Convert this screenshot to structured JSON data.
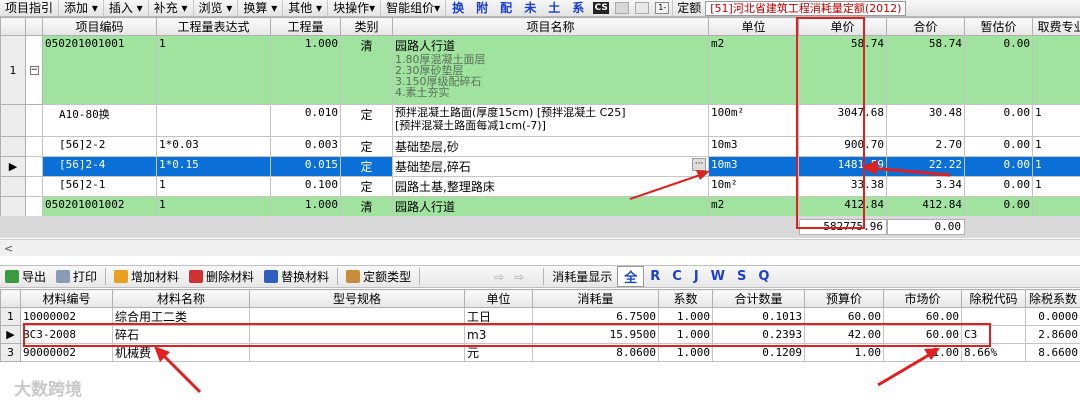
{
  "toolbar": {
    "items": [
      "项目指引",
      "添加 ▾",
      "插入 ▾",
      "补充 ▾",
      "浏览 ▾",
      "换算 ▾",
      "其他 ▾",
      "块操作▾",
      "智能组价▾"
    ],
    "quick": [
      "换",
      "附",
      "配",
      "未",
      "土",
      "系"
    ],
    "quota_label": "定额",
    "quota_value": "[51]河北省建筑工程消耗量定额(2012)"
  },
  "grid": {
    "headers": [
      "项目编码",
      "工程量表达式",
      "工程量",
      "类别",
      "项目名称",
      "单位",
      "单价",
      "合价",
      "暂估价",
      "取费专业"
    ],
    "rows": [
      {
        "idx": "1",
        "code": "050201001001",
        "expr": "1",
        "qty": "1.000",
        "type": "清",
        "name": "园路人行道",
        "desc": [
          "1.80厚混凝土面层",
          "2.30厚砂垫层",
          "3.150厚级配碎石",
          "4.素土夯实"
        ],
        "unit": "m2",
        "price": "58.74",
        "total": "58.74",
        "est": "0.00",
        "fee": ""
      },
      {
        "idx": "",
        "code": "A10-80换",
        "expr": "",
        "qty": "0.010",
        "type": "定",
        "name": "预拌混凝土路面(厚度15cm) [预拌混凝土 C25]",
        "name2": "[预拌混凝土路面每减1cm(-7)]",
        "unit": "100m²",
        "price": "3047.68",
        "total": "30.48",
        "est": "0.00",
        "fee": "1"
      },
      {
        "idx": "",
        "code": "[56]2-2",
        "expr": "1*0.03",
        "qty": "0.003",
        "type": "定",
        "name": "基础垫层,砂",
        "unit": "10m3",
        "price": "900.70",
        "total": "2.70",
        "est": "0.00",
        "fee": "1"
      },
      {
        "idx": "▶",
        "code": "[56]2-4",
        "expr": "1*0.15",
        "qty": "0.015",
        "type": "定",
        "name": "基础垫层,碎石",
        "unit": "10m3",
        "price": "1481.59",
        "total": "22.22",
        "est": "0.00",
        "fee": "1"
      },
      {
        "idx": "",
        "code": "[56]2-1",
        "expr": "1",
        "qty": "0.100",
        "type": "定",
        "name": "园路土基,整理路床",
        "unit": "10m²",
        "price": "33.38",
        "total": "3.34",
        "est": "0.00",
        "fee": "1"
      },
      {
        "idx": "",
        "code": "050201001002",
        "expr": "1",
        "qty": "1.000",
        "type": "清",
        "name": "园路人行道",
        "unit": "m2",
        "price": "412.84",
        "total": "412.84",
        "est": "0.00",
        "fee": ""
      }
    ],
    "summary_total": "582775.96",
    "summary_est": "0.00"
  },
  "bottom_toolbar": {
    "export": "导出",
    "print": "打印",
    "add_material": "增加材料",
    "delete_material": "删除材料",
    "replace_material": "替换材料",
    "quota_type": "定额类型",
    "consumption_display": "消耗量显示",
    "filters": [
      "全",
      "R",
      "C",
      "J",
      "W",
      "S",
      "Q"
    ]
  },
  "materials": {
    "headers": [
      "材料编号",
      "材料名称",
      "型号规格",
      "单位",
      "消耗量",
      "系数",
      "合计数量",
      "预算价",
      "市场价",
      "除税代码",
      "除税系数"
    ],
    "rows": [
      {
        "idx": "1",
        "code": "10000002",
        "name": "综合用工二类",
        "spec": "",
        "unit": "工日",
        "consume": "6.7500",
        "coef": "1.000",
        "sum": "0.1013",
        "budget": "60.00",
        "market": "60.00",
        "taxcode": "",
        "taxcoef": "0.0000"
      },
      {
        "idx": "▶",
        "code": "BC3-2008",
        "name": "碎石",
        "spec": "",
        "unit": "m3",
        "consume": "15.9500",
        "coef": "1.000",
        "sum": "0.2393",
        "budget": "42.00",
        "market": "60.00",
        "taxcode": "C3",
        "taxcoef": "2.8600"
      },
      {
        "idx": "3",
        "code": "90000002",
        "name": "机械费",
        "spec": "",
        "unit": "元",
        "consume": "8.0600",
        "coef": "1.000",
        "sum": "0.1209",
        "budget": "1.00",
        "market": "1.00",
        "taxcode": "8.66%",
        "taxcoef": "8.6600"
      }
    ]
  },
  "watermark": "大数跨境",
  "colors": {
    "highlight_green": "#9fe39f",
    "selection_blue": "#0a6fd6",
    "annotation_red": "#e0201e"
  }
}
